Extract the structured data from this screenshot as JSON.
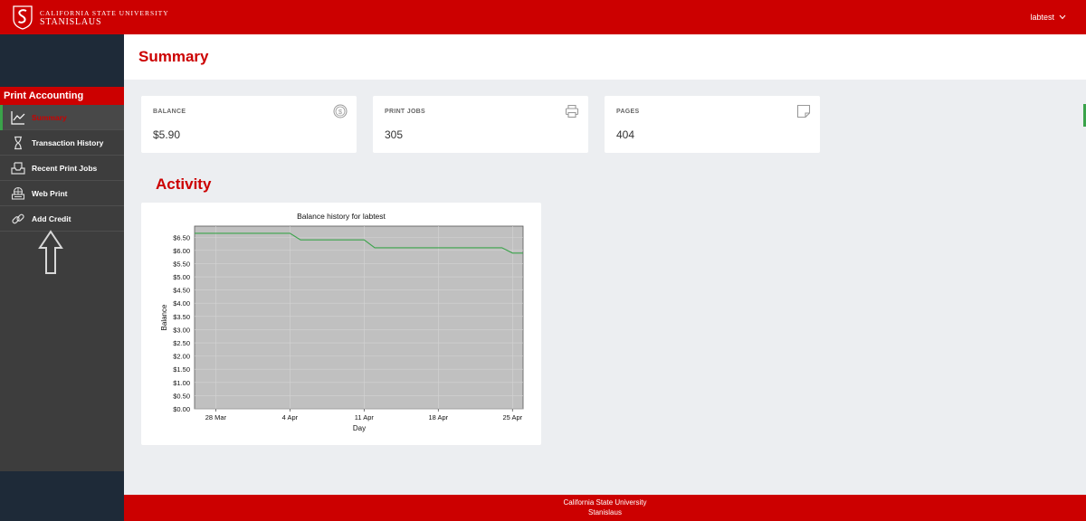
{
  "header": {
    "brand_line1": "CALIFORNIA STATE UNIVERSITY",
    "brand_line2": "STANISLAUS",
    "user": "labtest"
  },
  "sidebar": {
    "heading": "Print Accounting",
    "items": [
      {
        "label": "Summary",
        "icon": "line-chart-icon",
        "active": true
      },
      {
        "label": "Transaction History",
        "icon": "hourglass-icon"
      },
      {
        "label": "Recent Print Jobs",
        "icon": "inbox-tray-icon"
      },
      {
        "label": "Web Print",
        "icon": "printer-globe-icon"
      },
      {
        "label": "Add Credit",
        "icon": "link-icon"
      }
    ]
  },
  "main": {
    "title": "Summary",
    "cards": [
      {
        "label": "BALANCE",
        "value": "$5.90",
        "icon": "dollar-circle-icon"
      },
      {
        "label": "PRINT JOBS",
        "value": "305",
        "icon": "printer-icon"
      },
      {
        "label": "PAGES",
        "value": "404",
        "icon": "page-icon"
      }
    ],
    "activity_title": "Activity"
  },
  "chart_data": {
    "type": "line",
    "title": "Balance history for labtest",
    "xlabel": "Day",
    "ylabel": "Balance",
    "x_ticks": [
      "28 Mar",
      "4 Apr",
      "11 Apr",
      "18 Apr",
      "25 Apr"
    ],
    "y_ticks": [
      "$0.00",
      "$0.50",
      "$1.00",
      "$1.50",
      "$2.00",
      "$2.50",
      "$3.00",
      "$3.50",
      "$4.00",
      "$4.50",
      "$5.00",
      "$5.50",
      "$6.00",
      "$6.50"
    ],
    "ylim": [
      0,
      7.0
    ],
    "xlim_days": [
      "2025-03-26",
      "2025-04-26"
    ],
    "grid": true,
    "series": [
      {
        "color": "#3aa34a",
        "points": [
          [
            "2025-03-26",
            6.65
          ],
          [
            "2025-04-04",
            6.65
          ],
          [
            "2025-04-05",
            6.4
          ],
          [
            "2025-04-11",
            6.4
          ],
          [
            "2025-04-12",
            6.1
          ],
          [
            "2025-04-24",
            6.1
          ],
          [
            "2025-04-25",
            5.9
          ],
          [
            "2025-04-26",
            5.9
          ]
        ]
      }
    ]
  },
  "footer": {
    "line1": "California State University",
    "line2": "Stanislaus"
  },
  "colors": {
    "brand_red": "#cc0000",
    "sidebar_dark": "#3d3d3d",
    "navy": "#1e2a38",
    "accent_green": "#3aa34a"
  }
}
